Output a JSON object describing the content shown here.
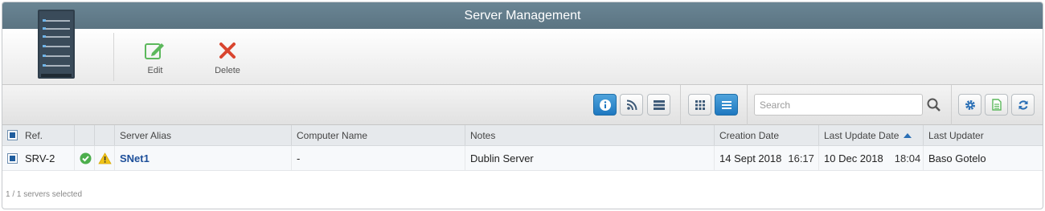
{
  "window": {
    "title": "Server Management"
  },
  "ribbon": {
    "edit_label": "Edit",
    "delete_label": "Delete",
    "edit_color": "#5cb85c",
    "delete_color": "#d9452f"
  },
  "toolbar": {
    "buttons": [
      "info-icon",
      "rss-icon",
      "server-list-icon",
      "grid-view-icon",
      "list-view-icon",
      "settings-icon",
      "export-icon",
      "refresh-icon"
    ],
    "search_placeholder": "Search"
  },
  "table": {
    "columns": [
      "Ref.",
      "",
      "",
      "Server Alias",
      "Computer Name",
      "Notes",
      "Creation Date",
      "Last Update Date",
      "Last Updater"
    ],
    "rows": [
      {
        "ref": "SRV-2",
        "status_icon": "check-circle-icon",
        "warning_icon": "warning-icon",
        "alias": "SNet1",
        "computer_name": "-",
        "notes": "Dublin Server",
        "creation_date": "14 Sept 2018",
        "creation_time": "16:17",
        "last_update_date": "10 Dec 2018",
        "last_update_time": "18:04",
        "last_updater": "Baso Gotelo"
      }
    ]
  },
  "status": {
    "selection_text": "1 / 1 servers selected"
  }
}
